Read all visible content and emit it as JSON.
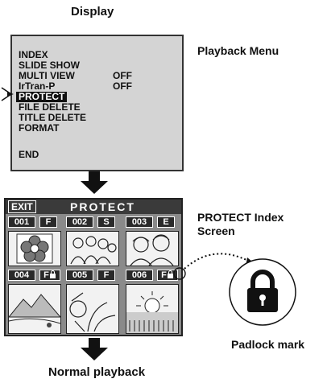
{
  "display_label": "Display",
  "playback_menu_label": "Playback Menu",
  "menu": {
    "items": [
      {
        "label": "INDEX",
        "value": ""
      },
      {
        "label": "SLIDE SHOW",
        "value": ""
      },
      {
        "label": "MULTI VIEW",
        "value": "OFF"
      },
      {
        "label": "IrTran-P",
        "value": "OFF"
      },
      {
        "label": "PROTECT",
        "value": "",
        "selected": true
      },
      {
        "label": "FILE DELETE",
        "value": ""
      },
      {
        "label": "TITLE DELETE",
        "value": ""
      },
      {
        "label": "FORMAT",
        "value": ""
      },
      {
        "label": "END",
        "value": ""
      }
    ]
  },
  "protect_screen": {
    "exit_label": "EXIT",
    "title": "PROTECT",
    "thumbnails": [
      {
        "num": "001",
        "tag": "F"
      },
      {
        "num": "002",
        "tag": "S"
      },
      {
        "num": "003",
        "tag": "E"
      },
      {
        "num": "004",
        "tag": "F"
      },
      {
        "num": "005",
        "tag": "F"
      },
      {
        "num": "006",
        "tag": "F"
      }
    ]
  },
  "protect_index_label_line1": "PROTECT Index",
  "protect_index_label_line2": "Screen",
  "padlock_label": "Padlock mark",
  "normal_playback_label": "Normal playback",
  "icons": [
    "down-arrow-icon",
    "padlock-icon",
    "flower-icon",
    "people-icon",
    "mountain-icon",
    "beach-icon",
    "sunset-icon"
  ]
}
